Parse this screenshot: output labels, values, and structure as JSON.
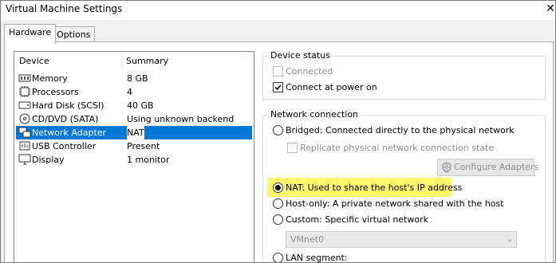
{
  "window": {
    "title": "Virtual Machine Settings",
    "close_label": "✕"
  },
  "tabs": [
    {
      "label": "Hardware",
      "active": true
    },
    {
      "label": "Options",
      "active": false
    }
  ],
  "device_list": {
    "columns": [
      "Device",
      "Summary"
    ],
    "rows": [
      {
        "name": "Memory",
        "summary": "8 GB",
        "icon": "memory-icon"
      },
      {
        "name": "Processors",
        "summary": "4",
        "icon": "processor-icon"
      },
      {
        "name": "Hard Disk (SCSI)",
        "summary": "40 GB",
        "icon": "hard-disk-icon"
      },
      {
        "name": "CD/DVD (SATA)",
        "summary": "Using unknown backend",
        "icon": "cd-dvd-icon"
      },
      {
        "name": "Network Adapter",
        "summary": "NAT",
        "icon": "network-adapter-icon",
        "selected": true
      },
      {
        "name": "USB Controller",
        "summary": "Present",
        "icon": "usb-controller-icon"
      },
      {
        "name": "Display",
        "summary": "1 monitor",
        "icon": "display-icon"
      }
    ]
  },
  "device_status": {
    "title": "Device status",
    "connected_label": "Connected",
    "connected_checked": false,
    "connected_enabled": false,
    "connect_at_power_on_label": "Connect at power on",
    "connect_at_power_on_checked": true
  },
  "network_connection": {
    "title": "Network connection",
    "bridged_label": "Bridged: Connected directly to the physical network",
    "replicate_label": "Replicate physical network connection state",
    "configure_adapters_label": "Configure Adapters",
    "nat_label": "NAT: Used to share the host's IP address",
    "host_only_label": "Host-only: A private network shared with the host",
    "custom_label": "Custom: Specific virtual network",
    "vmnet_value": "VMnet0",
    "lan_segment_label": "LAN segment:",
    "selected": "nat"
  },
  "colors": {
    "selection": "#0078d7",
    "highlight": "#fff86e",
    "dialog_bg": "#f0f0f0"
  }
}
